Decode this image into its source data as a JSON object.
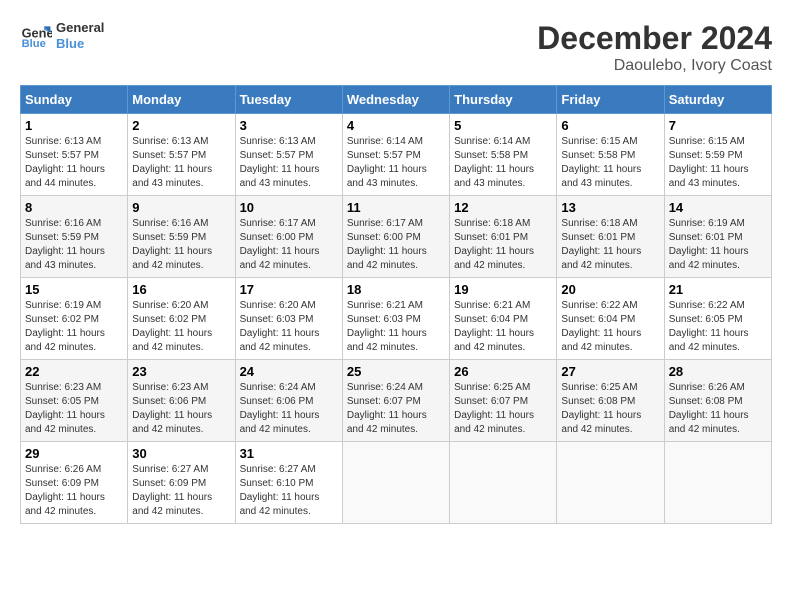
{
  "header": {
    "title": "December 2024",
    "subtitle": "Daoulebo, Ivory Coast",
    "logo_line1": "General",
    "logo_line2": "Blue"
  },
  "days_of_week": [
    "Sunday",
    "Monday",
    "Tuesday",
    "Wednesday",
    "Thursday",
    "Friday",
    "Saturday"
  ],
  "weeks": [
    [
      {
        "day": "1",
        "sunrise": "6:13 AM",
        "sunset": "5:57 PM",
        "daylight": "11 hours and 44 minutes."
      },
      {
        "day": "2",
        "sunrise": "6:13 AM",
        "sunset": "5:57 PM",
        "daylight": "11 hours and 43 minutes."
      },
      {
        "day": "3",
        "sunrise": "6:13 AM",
        "sunset": "5:57 PM",
        "daylight": "11 hours and 43 minutes."
      },
      {
        "day": "4",
        "sunrise": "6:14 AM",
        "sunset": "5:57 PM",
        "daylight": "11 hours and 43 minutes."
      },
      {
        "day": "5",
        "sunrise": "6:14 AM",
        "sunset": "5:58 PM",
        "daylight": "11 hours and 43 minutes."
      },
      {
        "day": "6",
        "sunrise": "6:15 AM",
        "sunset": "5:58 PM",
        "daylight": "11 hours and 43 minutes."
      },
      {
        "day": "7",
        "sunrise": "6:15 AM",
        "sunset": "5:59 PM",
        "daylight": "11 hours and 43 minutes."
      }
    ],
    [
      {
        "day": "8",
        "sunrise": "6:16 AM",
        "sunset": "5:59 PM",
        "daylight": "11 hours and 43 minutes."
      },
      {
        "day": "9",
        "sunrise": "6:16 AM",
        "sunset": "5:59 PM",
        "daylight": "11 hours and 42 minutes."
      },
      {
        "day": "10",
        "sunrise": "6:17 AM",
        "sunset": "6:00 PM",
        "daylight": "11 hours and 42 minutes."
      },
      {
        "day": "11",
        "sunrise": "6:17 AM",
        "sunset": "6:00 PM",
        "daylight": "11 hours and 42 minutes."
      },
      {
        "day": "12",
        "sunrise": "6:18 AM",
        "sunset": "6:01 PM",
        "daylight": "11 hours and 42 minutes."
      },
      {
        "day": "13",
        "sunrise": "6:18 AM",
        "sunset": "6:01 PM",
        "daylight": "11 hours and 42 minutes."
      },
      {
        "day": "14",
        "sunrise": "6:19 AM",
        "sunset": "6:01 PM",
        "daylight": "11 hours and 42 minutes."
      }
    ],
    [
      {
        "day": "15",
        "sunrise": "6:19 AM",
        "sunset": "6:02 PM",
        "daylight": "11 hours and 42 minutes."
      },
      {
        "day": "16",
        "sunrise": "6:20 AM",
        "sunset": "6:02 PM",
        "daylight": "11 hours and 42 minutes."
      },
      {
        "day": "17",
        "sunrise": "6:20 AM",
        "sunset": "6:03 PM",
        "daylight": "11 hours and 42 minutes."
      },
      {
        "day": "18",
        "sunrise": "6:21 AM",
        "sunset": "6:03 PM",
        "daylight": "11 hours and 42 minutes."
      },
      {
        "day": "19",
        "sunrise": "6:21 AM",
        "sunset": "6:04 PM",
        "daylight": "11 hours and 42 minutes."
      },
      {
        "day": "20",
        "sunrise": "6:22 AM",
        "sunset": "6:04 PM",
        "daylight": "11 hours and 42 minutes."
      },
      {
        "day": "21",
        "sunrise": "6:22 AM",
        "sunset": "6:05 PM",
        "daylight": "11 hours and 42 minutes."
      }
    ],
    [
      {
        "day": "22",
        "sunrise": "6:23 AM",
        "sunset": "6:05 PM",
        "daylight": "11 hours and 42 minutes."
      },
      {
        "day": "23",
        "sunrise": "6:23 AM",
        "sunset": "6:06 PM",
        "daylight": "11 hours and 42 minutes."
      },
      {
        "day": "24",
        "sunrise": "6:24 AM",
        "sunset": "6:06 PM",
        "daylight": "11 hours and 42 minutes."
      },
      {
        "day": "25",
        "sunrise": "6:24 AM",
        "sunset": "6:07 PM",
        "daylight": "11 hours and 42 minutes."
      },
      {
        "day": "26",
        "sunrise": "6:25 AM",
        "sunset": "6:07 PM",
        "daylight": "11 hours and 42 minutes."
      },
      {
        "day": "27",
        "sunrise": "6:25 AM",
        "sunset": "6:08 PM",
        "daylight": "11 hours and 42 minutes."
      },
      {
        "day": "28",
        "sunrise": "6:26 AM",
        "sunset": "6:08 PM",
        "daylight": "11 hours and 42 minutes."
      }
    ],
    [
      {
        "day": "29",
        "sunrise": "6:26 AM",
        "sunset": "6:09 PM",
        "daylight": "11 hours and 42 minutes."
      },
      {
        "day": "30",
        "sunrise": "6:27 AM",
        "sunset": "6:09 PM",
        "daylight": "11 hours and 42 minutes."
      },
      {
        "day": "31",
        "sunrise": "6:27 AM",
        "sunset": "6:10 PM",
        "daylight": "11 hours and 42 minutes."
      },
      null,
      null,
      null,
      null
    ]
  ]
}
